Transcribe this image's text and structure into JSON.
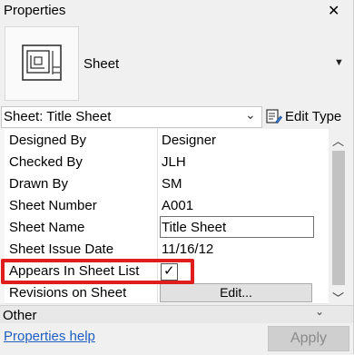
{
  "window": {
    "title": "Properties",
    "close_glyph": "✕"
  },
  "type_selector": {
    "icon": "sheet-icon",
    "type_name": "Sheet",
    "dropdown_glyph": "▼"
  },
  "instance_selector": {
    "value": "Sheet: Title Sheet",
    "chevron_glyph": "⌄",
    "edit_type_label": "Edit Type",
    "edit_type_icon": "edit-type-icon"
  },
  "properties": {
    "rows": [
      {
        "name": "Designed By",
        "value": "Designer"
      },
      {
        "name": "Checked By",
        "value": "JLH"
      },
      {
        "name": "Drawn By",
        "value": "SM"
      },
      {
        "name": "Sheet Number",
        "value": "A001"
      },
      {
        "name": "Sheet Name",
        "value": "Title Sheet"
      },
      {
        "name": "Sheet Issue Date",
        "value": "11/16/12"
      },
      {
        "name": "Appears In Sheet List",
        "value": "checked"
      },
      {
        "name": "Revisions on Sheet",
        "value": "Edit..."
      }
    ],
    "checkbox_glyph": "✓",
    "highlight_color": "#e01e1e"
  },
  "scrollbar": {
    "up_glyph": "︿",
    "down_glyph": "﹀"
  },
  "category_other": {
    "label": "Other",
    "chevron_glyph": "⌄"
  },
  "footer": {
    "help_link": "Properties help",
    "apply_label": "Apply"
  }
}
